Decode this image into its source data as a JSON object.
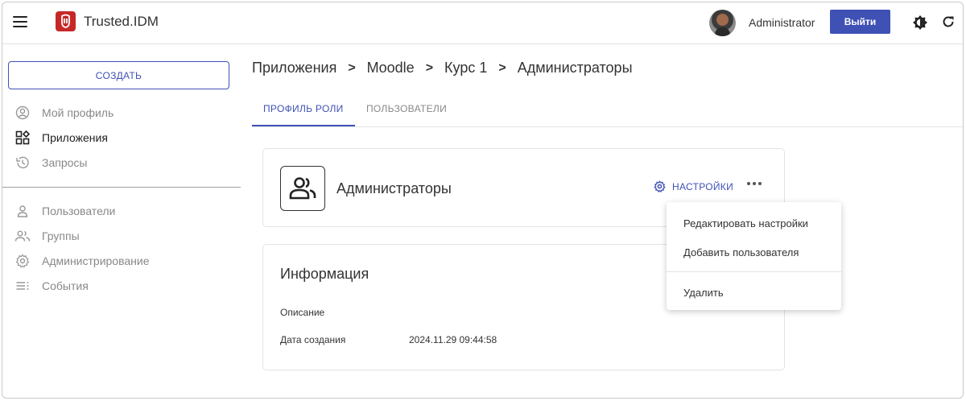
{
  "header": {
    "app_title": "Trusted.IDM",
    "user_name": "Administrator",
    "logout_label": "Выйти"
  },
  "sidebar": {
    "create_label": "СОЗДАТЬ",
    "items": [
      {
        "label": "Мой профиль",
        "icon": "profile-icon"
      },
      {
        "label": "Приложения",
        "icon": "apps-icon"
      },
      {
        "label": "Запросы",
        "icon": "history-icon"
      },
      {
        "label": "Пользователи",
        "icon": "user-icon"
      },
      {
        "label": "Группы",
        "icon": "group-icon"
      },
      {
        "label": "Администрирование",
        "icon": "gear-icon"
      },
      {
        "label": "События",
        "icon": "list-icon"
      }
    ]
  },
  "breadcrumb": [
    "Приложения",
    "Moodle",
    "Курс 1",
    "Администраторы"
  ],
  "tabs": {
    "active": "ПРОФИЛЬ РОЛИ",
    "inactive": "ПОЛЬЗОВАТЕЛИ"
  },
  "role_card": {
    "title": "Администраторы",
    "settings_label": "НАСТРОЙКИ"
  },
  "info_card": {
    "title": "Информация",
    "description_label": "Описание",
    "created_label": "Дата создания",
    "created_value": "2024.11.29 09:44:58"
  },
  "menu": {
    "edit_settings": "Редактировать настройки",
    "add_user": "Добавить пользователя",
    "delete": "Удалить"
  },
  "colors": {
    "accent": "#3f51b5",
    "logo": "#c62828"
  }
}
